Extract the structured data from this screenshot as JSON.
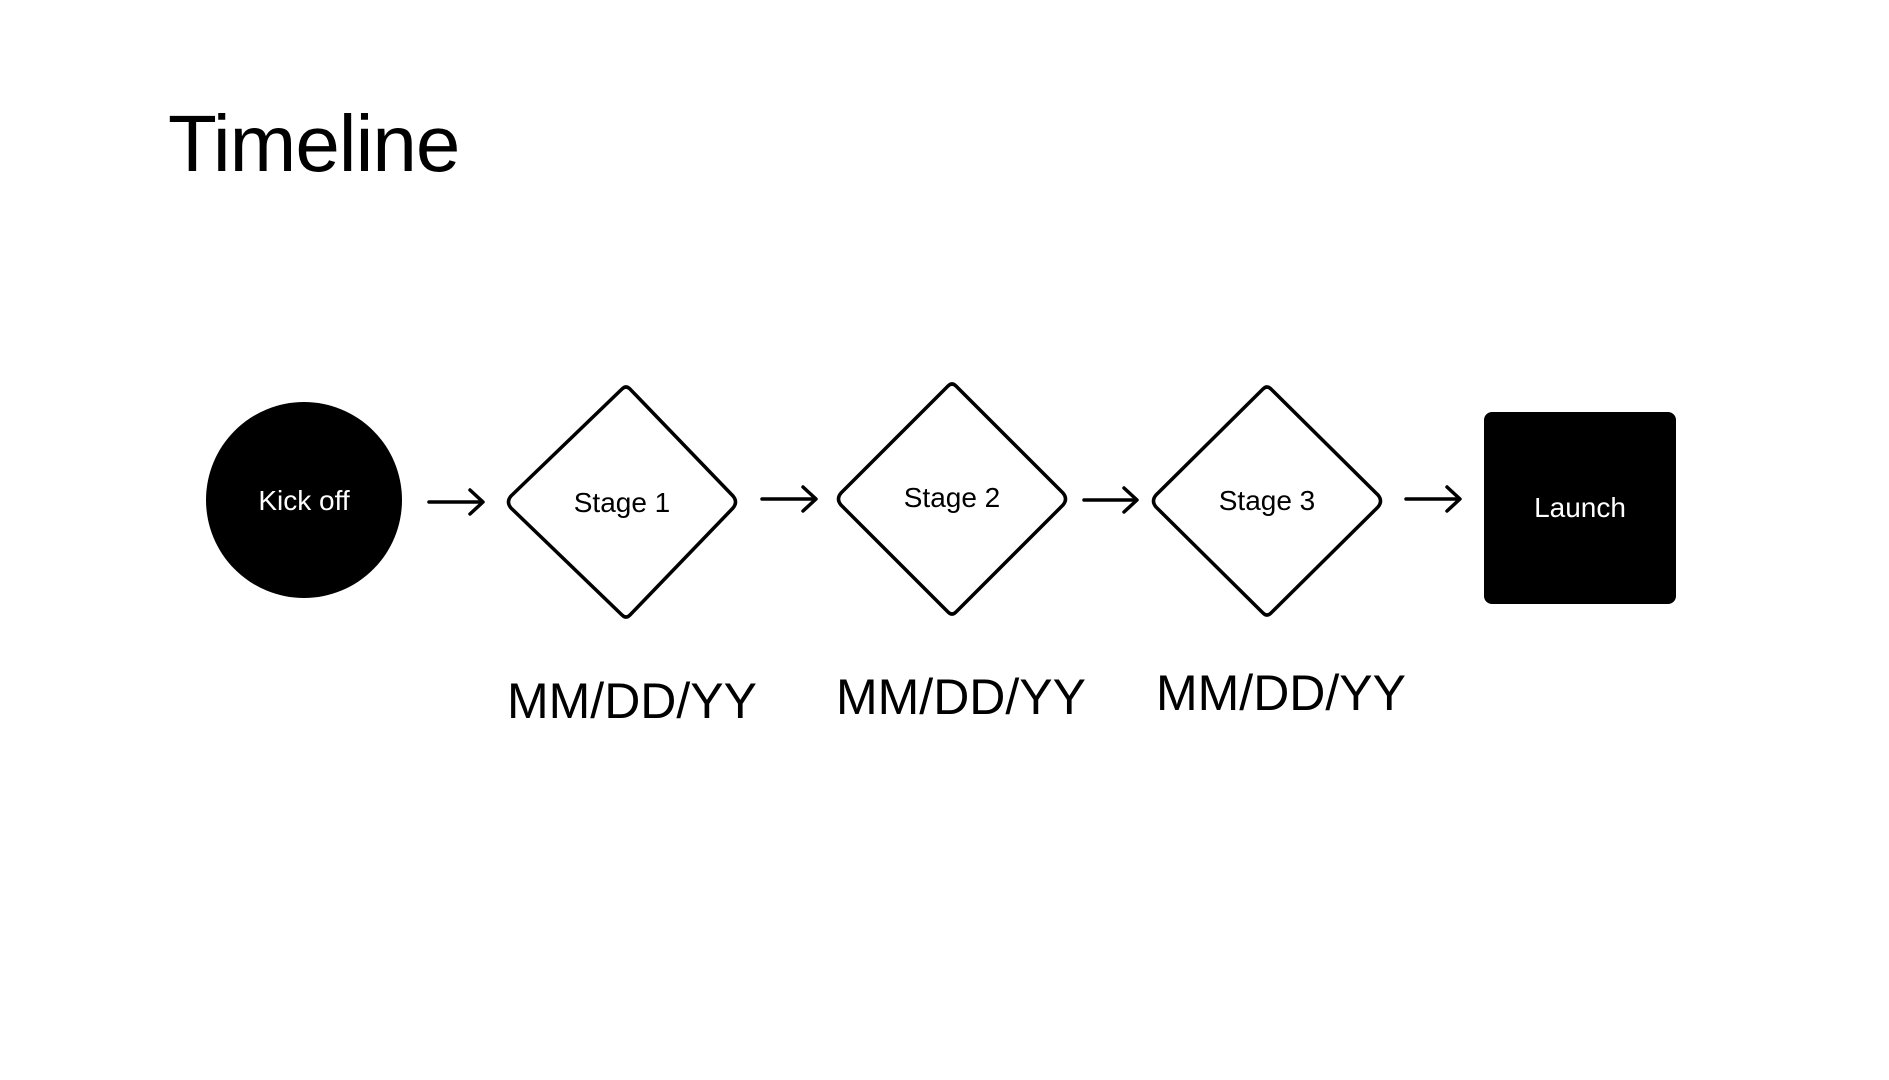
{
  "page": {
    "title": "Timeline"
  },
  "colors": {
    "foreground": "#000000",
    "background": "#ffffff",
    "inverse_text": "#ffffff"
  },
  "nodes": [
    {
      "id": "kickoff",
      "shape": "circle",
      "label": "Kick off",
      "filled": true
    },
    {
      "id": "stage1",
      "shape": "diamond",
      "label": "Stage 1",
      "filled": false,
      "date": "MM/DD/YY"
    },
    {
      "id": "stage2",
      "shape": "diamond",
      "label": "Stage 2",
      "filled": false,
      "date": "MM/DD/YY"
    },
    {
      "id": "stage3",
      "shape": "diamond",
      "label": "Stage 3",
      "filled": false,
      "date": "MM/DD/YY"
    },
    {
      "id": "launch",
      "shape": "rounded-square",
      "label": "Launch",
      "filled": true
    }
  ],
  "edges": [
    {
      "from": "kickoff",
      "to": "stage1",
      "icon": "arrow-right-icon"
    },
    {
      "from": "stage1",
      "to": "stage2",
      "icon": "arrow-right-icon"
    },
    {
      "from": "stage2",
      "to": "stage3",
      "icon": "arrow-right-icon"
    },
    {
      "from": "stage3",
      "to": "launch",
      "icon": "arrow-right-icon"
    }
  ]
}
